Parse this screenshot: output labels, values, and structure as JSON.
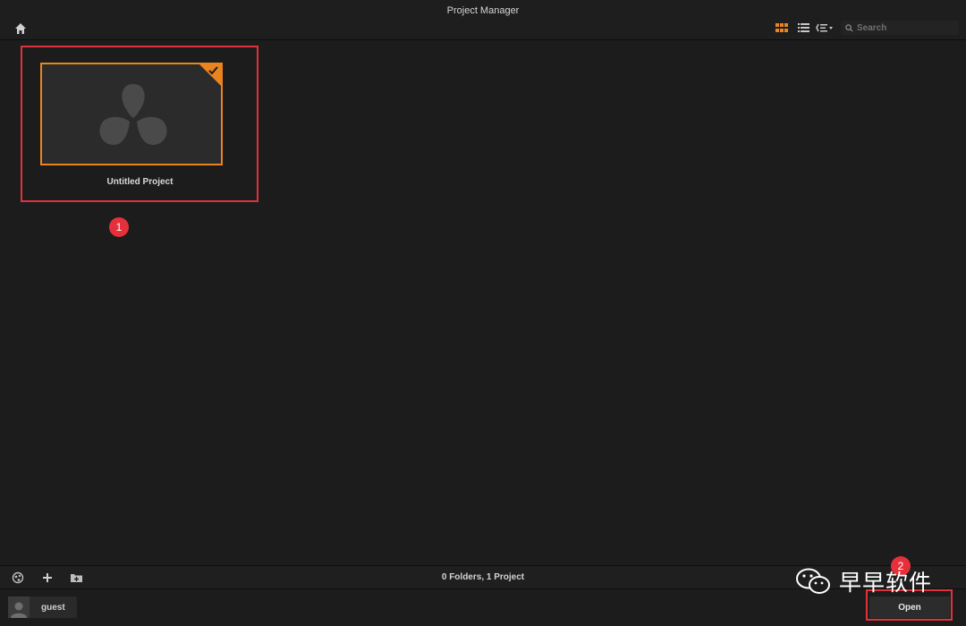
{
  "window": {
    "title": "Project Manager"
  },
  "toolbar": {
    "home_icon": "home-icon",
    "grid_view_icon": "grid-view-icon",
    "list_view_icon": "list-view-icon",
    "sort_icon": "sort-options-icon",
    "search_placeholder": "Search"
  },
  "projects": [
    {
      "name": "Untitled Project",
      "selected": true
    }
  ],
  "annotations": {
    "badge_1": "1",
    "badge_2": "2"
  },
  "status": {
    "counts": "0 Folders, 1 Project"
  },
  "bottom_icons": [
    "network-icon",
    "plus-icon",
    "add-folder-icon"
  ],
  "user": {
    "name": "guest"
  },
  "actions": {
    "open_label": "Open"
  },
  "watermark": {
    "text": "早早软件"
  },
  "colors": {
    "accent": "#e98420",
    "annotation": "#e0323a",
    "background": "#1c1c1d"
  }
}
